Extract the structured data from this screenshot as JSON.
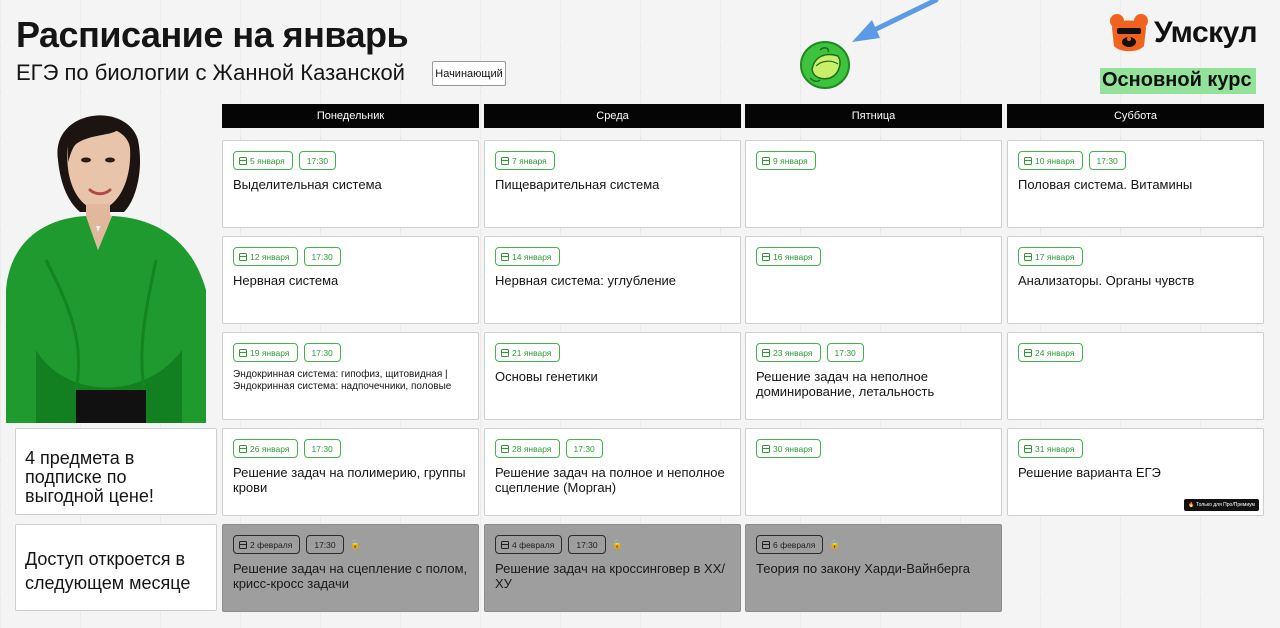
{
  "header": {
    "title": "Расписание на январь",
    "subtitle": "ЕГЭ по биологии с Жанной Казанской",
    "level": "Начинающий"
  },
  "brand": {
    "logo_text": "Умскул",
    "course_label": "Основной курс",
    "accent_color": "#93e29a"
  },
  "days": [
    "Понедельник",
    "Среда",
    "Пятница",
    "Суббота"
  ],
  "rows": [
    [
      {
        "date": "5 января",
        "time": "17:30",
        "title": "Выделительная система"
      },
      {
        "date": "7 января",
        "title": "Пищеварительная система"
      },
      {
        "date": "9 января",
        "title": ""
      },
      {
        "date": "10 января",
        "time": "17:30",
        "title": "Половая система. Витамины"
      }
    ],
    [
      {
        "date": "12 января",
        "time": "17:30",
        "title": "Нервная система"
      },
      {
        "date": "14 января",
        "title": "Нервная система: углубление"
      },
      {
        "date": "16 января",
        "title": ""
      },
      {
        "date": "17 января",
        "title": "Анализаторы. Органы чувств"
      }
    ],
    [
      {
        "date": "19 января",
        "time": "17:30",
        "title": "Эндокринная система: гипофиз, щитовидная | Эндокринная система: надпочечники, половые"
      },
      {
        "date": "21 января",
        "title": "Основы генетики"
      },
      {
        "date": "23 января",
        "time": "17:30",
        "title": "Решение задач на неполное доминирование, летальность"
      },
      {
        "date": "24 января",
        "title": ""
      }
    ],
    [
      {
        "date": "26 января",
        "time": "17:30",
        "title": "Решение задач на полимерию, группы крови"
      },
      {
        "date": "28 января",
        "time": "17:30",
        "title": "Решение задач на полное и неполное сцепление (Морган)"
      },
      {
        "date": "30 января",
        "title": ""
      },
      {
        "date": "31 января",
        "title": "Решение варианта ЕГЭ",
        "badge": "🔥 Только для Про/Премиум"
      }
    ],
    [
      {
        "date": "2 февраля",
        "time": "17:30",
        "title": "Решение задач на сцепление с полом, крисс-кросс задачи",
        "locked": true
      },
      {
        "date": "4 февраля",
        "time": "17:30",
        "title": "Решение задач на кроссинговер в ХХ/ХУ",
        "locked": true
      },
      {
        "date": "6 февраля",
        "title": "Теория по закону Харди-Вайнберга",
        "locked": true
      }
    ]
  ],
  "side": {
    "promo": "4 предмета в подписке по выгодной цене!",
    "access": "Доступ откроется в следующем месяце"
  },
  "icons": {
    "calendar": "calendar-icon",
    "lock": "lock-icon",
    "arrow": "arrow-icon",
    "mascot": "tennis-ball-icon",
    "logo": "bear-logo-icon"
  }
}
